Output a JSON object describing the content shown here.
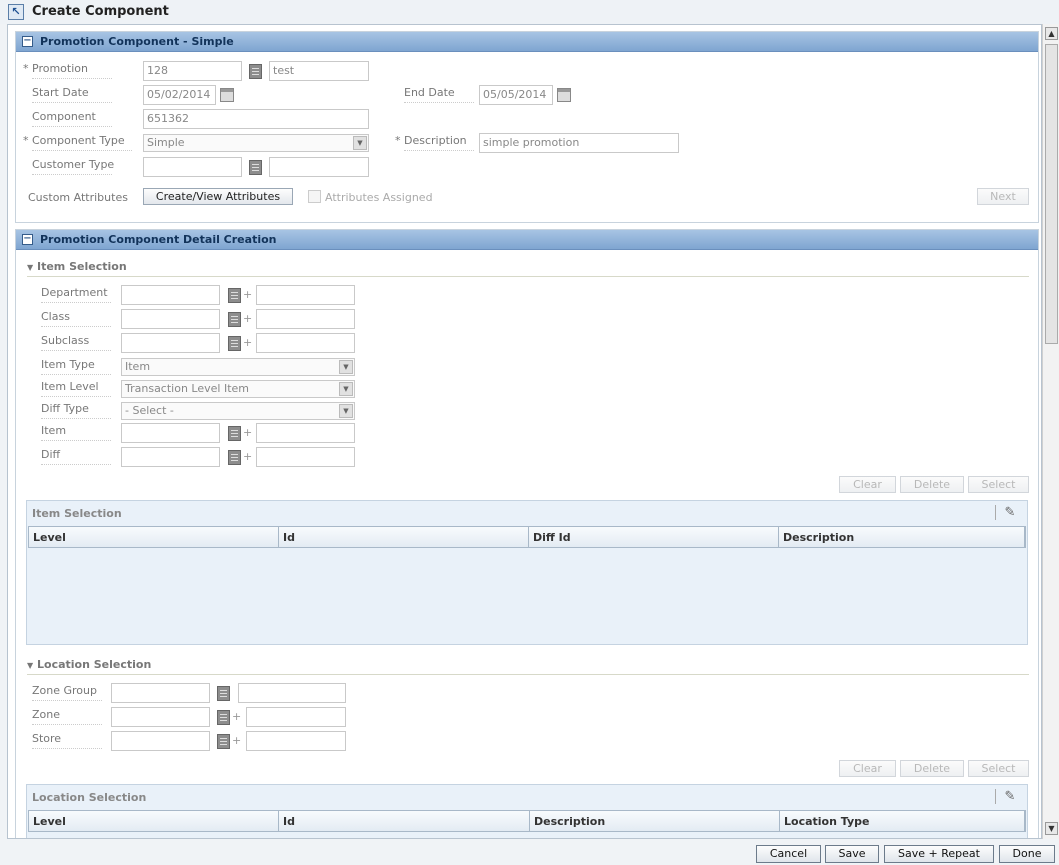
{
  "window": {
    "title": "Create Component"
  },
  "component_panel": {
    "title": "Promotion Component - Simple",
    "promotion": {
      "label": "Promotion",
      "value": "128",
      "desc": "test"
    },
    "start_date": {
      "label": "Start Date",
      "value": "05/02/2014"
    },
    "end_date": {
      "label": "End Date",
      "value": "05/05/2014"
    },
    "component": {
      "label": "Component",
      "value": "651362"
    },
    "component_type": {
      "label": "Component Type",
      "value": "Simple"
    },
    "description": {
      "label": "Description",
      "value": "simple promotion"
    },
    "customer_type": {
      "label": "Customer Type",
      "value": "",
      "desc": ""
    },
    "custom_attributes": {
      "label": "Custom Attributes",
      "button": "Create/View Attributes",
      "checkbox_label": "Attributes Assigned"
    },
    "next_button": "Next",
    "required_marker": "*"
  },
  "detail_panel": {
    "title": "Promotion Component Detail Creation",
    "item_selection": {
      "header": "Item Selection",
      "department": {
        "label": "Department"
      },
      "class": {
        "label": "Class"
      },
      "subclass": {
        "label": "Subclass"
      },
      "item_type": {
        "label": "Item Type",
        "value": "Item"
      },
      "item_level": {
        "label": "Item Level",
        "value": "Transaction Level Item"
      },
      "diff_type": {
        "label": "Diff Type",
        "value": "- Select -"
      },
      "item": {
        "label": "Item"
      },
      "diff": {
        "label": "Diff"
      },
      "buttons": {
        "clear": "Clear",
        "delete": "Delete",
        "select": "Select"
      },
      "table": {
        "title": "Item Selection",
        "columns": [
          "Level",
          "Id",
          "Diff Id",
          "Description"
        ]
      }
    },
    "location_selection": {
      "header": "Location Selection",
      "zone_group": {
        "label": "Zone Group"
      },
      "zone": {
        "label": "Zone"
      },
      "store": {
        "label": "Store"
      },
      "buttons": {
        "clear": "Clear",
        "delete": "Delete",
        "select": "Select"
      },
      "table": {
        "title": "Location Selection",
        "columns": [
          "Level",
          "Id",
          "Description",
          "Location Type"
        ]
      }
    }
  },
  "footer": {
    "cancel": "Cancel",
    "save": "Save",
    "save_repeat": "Save + Repeat",
    "done": "Done"
  },
  "icons": {
    "window": "resize-arrow-icon",
    "collapse": "collapse-icon",
    "lov": "list-of-values-icon",
    "calendar": "calendar-icon",
    "edit": "edit-pencil-icon",
    "expand": "triangle-down-icon"
  }
}
